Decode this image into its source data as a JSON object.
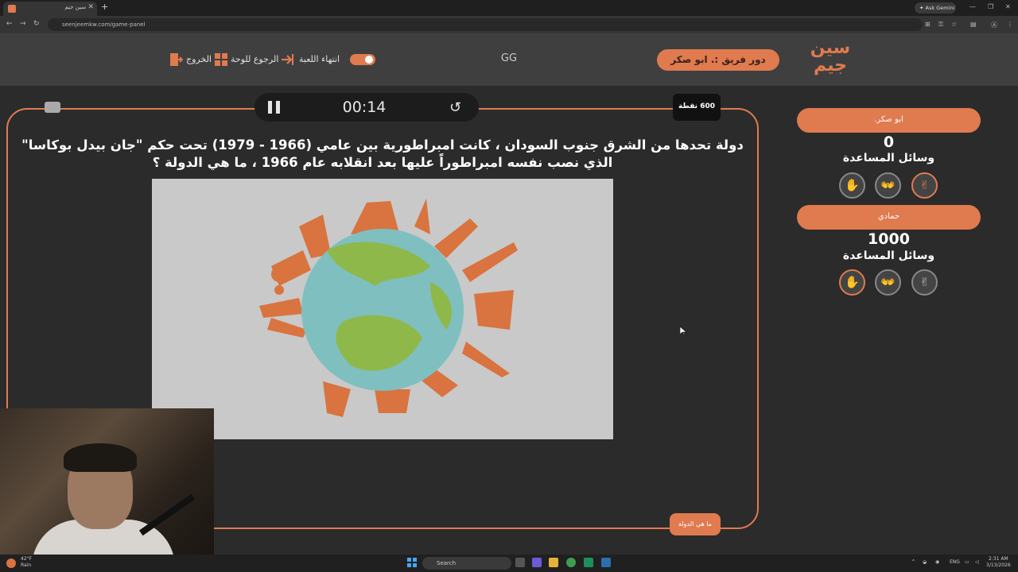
{
  "browser": {
    "tab_title": "سين جيم",
    "url": "seenjeemkw.com/game-panel",
    "gemini_label": "Ask Gemini"
  },
  "header": {
    "logo_line1": "سين",
    "logo_line2": "جيم",
    "turn_label": "دور فريق :. ابو صكر",
    "center_text": "GG",
    "end_game_label": "انتهاء اللعبة",
    "back_to_board_label": "الرجوع للوحة",
    "exit_label": "الخروج"
  },
  "board": {
    "timer": "00:14",
    "points": "600 نقطة",
    "question": "دولة تحدها من الشرق جنوب السودان ، كانت امبراطورية بين عامي (1966 - 1979) تحت حكم \"جان بيدل بوكاسا\" الذي نصب نفسه امبراطوراً عليها بعد انقلابه عام 1966 ، ما هي الدولة ؟",
    "answer_button": "ما هي الدولة"
  },
  "teams": [
    {
      "name": "ابو صكر.",
      "score": "0",
      "aids_label": "وسائل المساعدة",
      "lifelines": [
        "hand-stop-icon",
        "two-hands-icon",
        "peace-hand-icon"
      ],
      "active": [
        false,
        false,
        true
      ]
    },
    {
      "name": "حمادي",
      "score": "1000",
      "aids_label": "وسائل المساعدة",
      "lifelines": [
        "hand-stop-icon",
        "two-hands-icon",
        "peace-hand-icon"
      ],
      "active": [
        true,
        false,
        false
      ]
    }
  ],
  "taskbar": {
    "weather_temp": "42°F",
    "weather_text": "Rain",
    "search_placeholder": "Search",
    "lang": "ENG",
    "time": "2:31 AM",
    "date": "3/13/2026"
  },
  "colors": {
    "accent": "#e07a4f",
    "background": "#2b2b2b",
    "header": "#3f3f3f"
  }
}
